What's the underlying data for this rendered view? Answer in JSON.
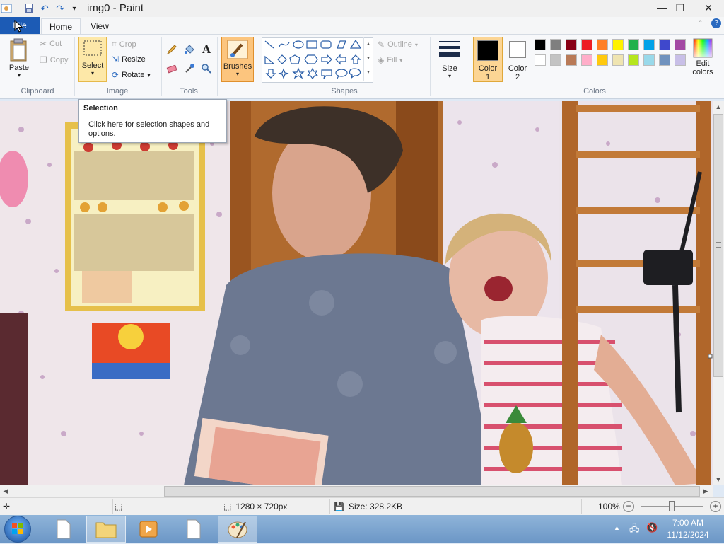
{
  "window": {
    "title": "img0 - Paint"
  },
  "ribbon_tabs": {
    "file": "File",
    "home": "Home",
    "view": "View"
  },
  "clipboard": {
    "paste": "Paste",
    "cut": "Cut",
    "copy": "Copy",
    "group": "Clipboard"
  },
  "image": {
    "select": "Select",
    "crop": "Crop",
    "resize": "Resize",
    "rotate": "Rotate",
    "group": "Image"
  },
  "tools": {
    "group": "Tools"
  },
  "brushes": {
    "label": "Brushes"
  },
  "shapes": {
    "outline": "Outline",
    "fill": "Fill",
    "group": "Shapes"
  },
  "size": {
    "label": "Size"
  },
  "colors": {
    "color1": "Color 1",
    "color2": "Color 2",
    "edit": "Edit colors",
    "group": "Colors",
    "color1_value": "#000000",
    "color2_value": "#ffffff",
    "palette_row1": [
      "#000000",
      "#7f7f7f",
      "#880015",
      "#ed1c24",
      "#ff7f27",
      "#fff200",
      "#22b14c",
      "#00a2e8",
      "#3f48cc",
      "#a349a4"
    ],
    "palette_row2": [
      "#ffffff",
      "#c3c3c3",
      "#b97a57",
      "#ffaec9",
      "#ffc90e",
      "#efe4b0",
      "#b5e61d",
      "#99d9ea",
      "#7092be",
      "#c8bfe7"
    ]
  },
  "tooltip": {
    "title": "Selection",
    "body": "Click here for selection shapes and options."
  },
  "status": {
    "dimensions": "1280 × 720px",
    "size": "Size: 328.2KB",
    "zoom": "100%"
  },
  "taskbar": {
    "time": "7:00 AM",
    "date": "11/12/2024"
  }
}
